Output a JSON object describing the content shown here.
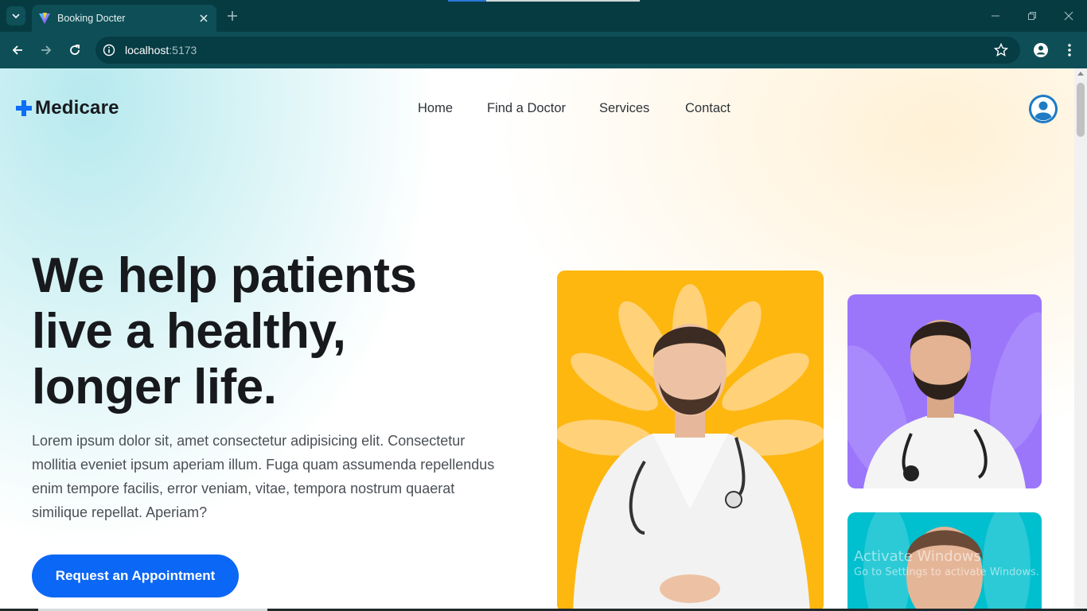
{
  "browser": {
    "tab_title": "Booking Docter",
    "url_host": "localhost",
    "url_port": ":5173",
    "theme_color": "#0e4f57"
  },
  "site": {
    "logo_text": "Medicare",
    "brand_color": "#0e6ef5",
    "nav": [
      "Home",
      "Find a Doctor",
      "Services",
      "Contact"
    ]
  },
  "hero": {
    "title_lines": [
      "We help patients",
      "live a healthy,",
      "longer life."
    ],
    "description": "Lorem ipsum dolor sit, amet consectetur adipisicing elit. Consectetur mollitia eveniet ipsum aperiam illum. Fuga quam assumenda repellendus enim tempore facilis, error veniam, vitae, tempora nostrum quaerat similique repellat. Aperiam?",
    "cta_label": "Request an Appointment",
    "card_colors": [
      "#fdb70f",
      "#9b76fb",
      "#00bfce"
    ]
  },
  "overlay": {
    "title": "Activate Windows",
    "subtitle": "Go to Settings to activate Windows."
  }
}
